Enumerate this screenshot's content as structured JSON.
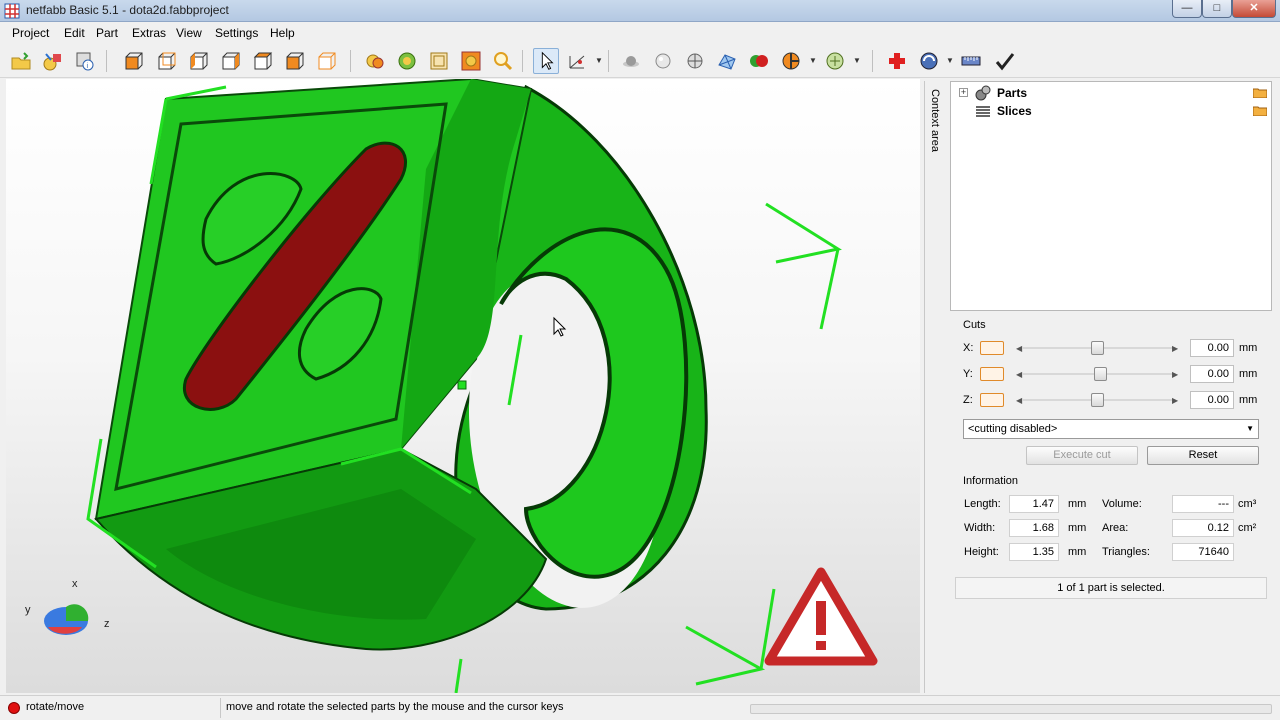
{
  "window": {
    "title": "netfabb Basic 5.1 - dota2d.fabbproject"
  },
  "menu": [
    "Project",
    "Edit",
    "Part",
    "Extras",
    "View",
    "Settings",
    "Help"
  ],
  "toolbar": {
    "icons": [
      "open-project-icon",
      "add-part-icon",
      "part-info-icon",
      "view-front-icon",
      "view-back-icon",
      "view-left-icon",
      "view-right-icon",
      "view-top-icon",
      "view-bottom-icon",
      "zoom-selection-icon",
      "zoom-all-icon",
      "zoom-box-icon",
      "zoom-fit-icon",
      "zoom-icon",
      "select-pointer-icon",
      "measure-icon",
      "sphere-shading-icon",
      "sphere-smooth-icon",
      "sphere-points-icon",
      "mesh-icon",
      "colors-icon",
      "section-icon",
      "repair-tree-icon",
      "repair-cross-icon",
      "analysis-icon",
      "ruler-icon",
      "apply-check-icon"
    ]
  },
  "context": {
    "label": "Context area"
  },
  "tree": {
    "items": [
      {
        "label": "Parts",
        "icon": "parts-icon"
      },
      {
        "label": "Slices",
        "icon": "slices-icon"
      }
    ]
  },
  "cuts": {
    "title": "Cuts",
    "axes": [
      {
        "label": "X:",
        "value": "0.00",
        "unit": "mm",
        "slider": 0.5
      },
      {
        "label": "Y:",
        "value": "0.00",
        "unit": "mm",
        "slider": 0.52
      },
      {
        "label": "Z:",
        "value": "0.00",
        "unit": "mm",
        "slider": 0.5
      }
    ],
    "mode": "<cutting disabled>",
    "execute_label": "Execute cut",
    "reset_label": "Reset"
  },
  "information": {
    "title": "Information",
    "length_label": "Length:",
    "length_value": "1.47",
    "length_unit": "mm",
    "width_label": "Width:",
    "width_value": "1.68",
    "width_unit": "mm",
    "height_label": "Height:",
    "height_value": "1.35",
    "height_unit": "mm",
    "volume_label": "Volume:",
    "volume_value": "---",
    "volume_unit": "cm³",
    "area_label": "Area:",
    "area_value": "0.12",
    "area_unit": "cm²",
    "triangles_label": "Triangles:",
    "triangles_value": "71640"
  },
  "selection": {
    "text": "1 of 1 part is selected."
  },
  "status": {
    "mode": "rotate/move",
    "hint": "move and rotate the selected parts by the mouse and the cursor keys"
  },
  "axes_gizmo": {
    "x": "x",
    "y": "y",
    "z": "z"
  },
  "colors": {
    "part": "#17c417",
    "part_dark": "#0a5a0a",
    "highlight": "#8b1010",
    "warning": "#c62828"
  }
}
